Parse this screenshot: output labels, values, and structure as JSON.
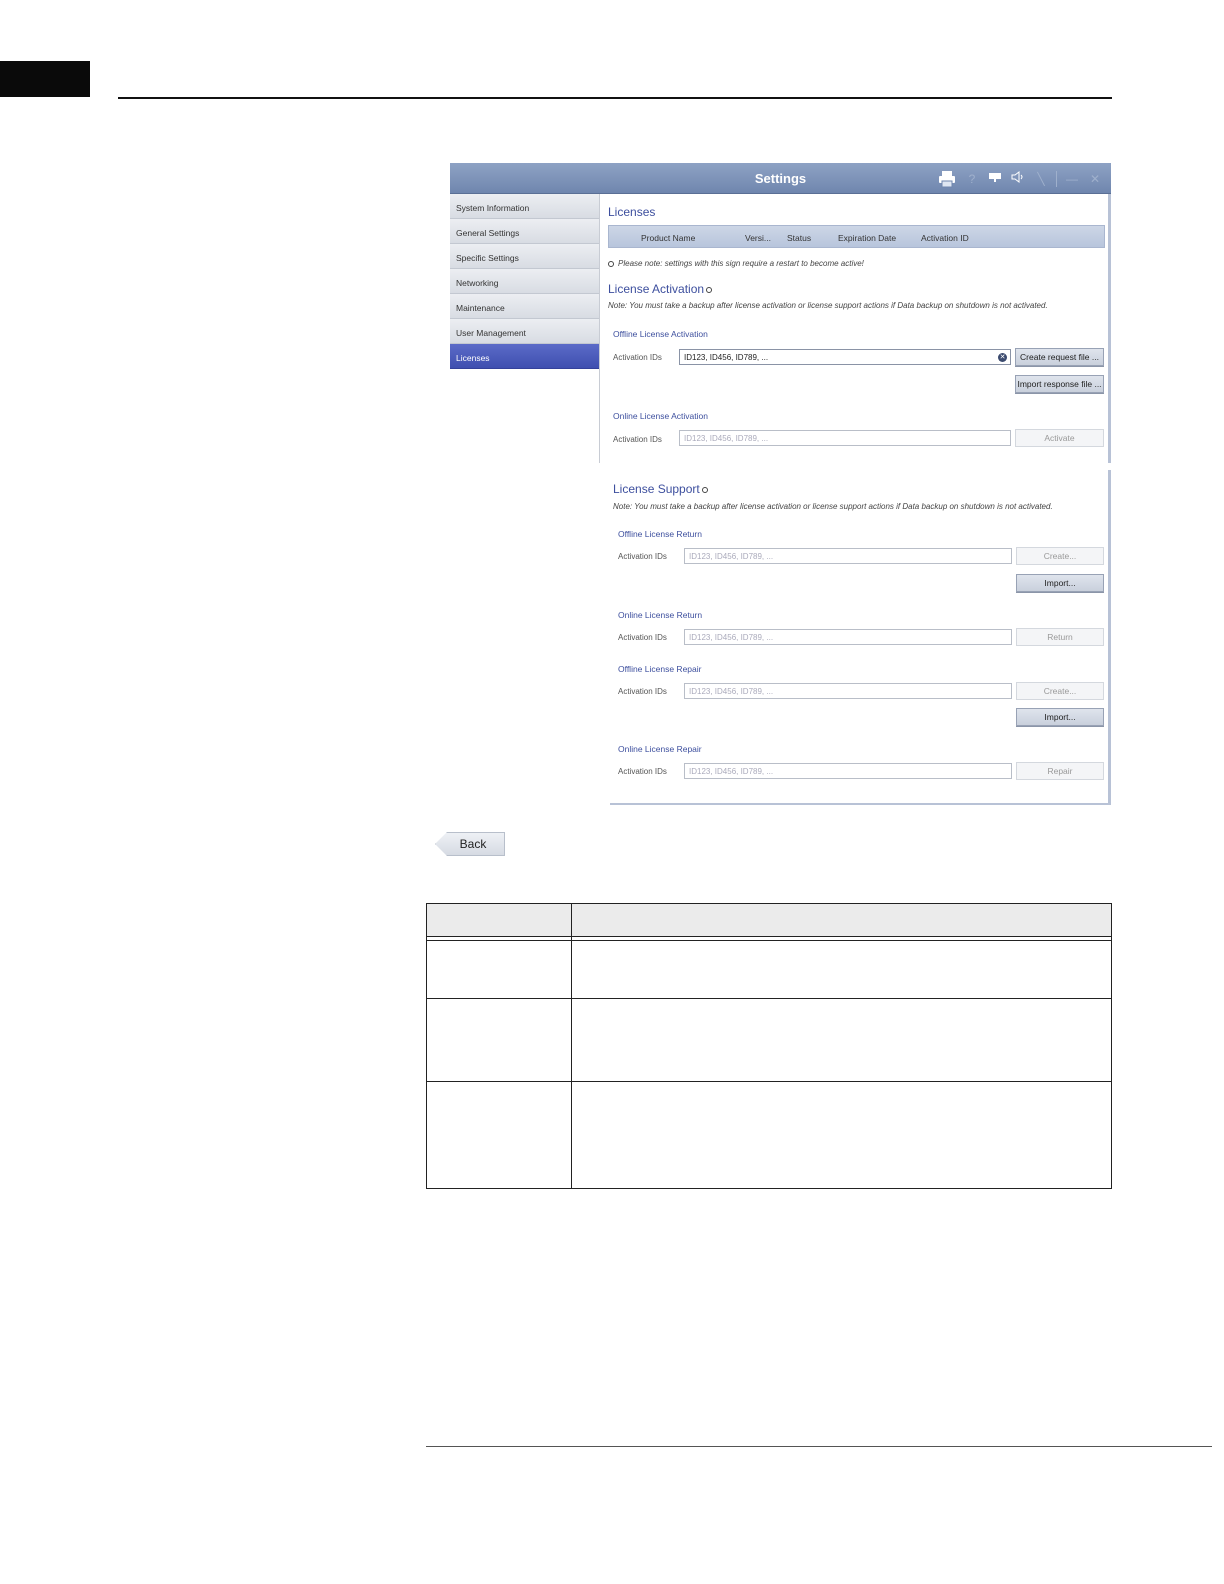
{
  "window": {
    "title": "Settings"
  },
  "sidebar": {
    "items": [
      {
        "label": "System Information"
      },
      {
        "label": "General Settings"
      },
      {
        "label": "Specific Settings"
      },
      {
        "label": "Networking"
      },
      {
        "label": "Maintenance"
      },
      {
        "label": "User Management"
      },
      {
        "label": "Licenses",
        "active": true
      }
    ]
  },
  "licenses": {
    "heading": "Licenses",
    "columns": [
      "Product Name",
      "Versi...",
      "Status",
      "Expiration Date",
      "Activation ID"
    ],
    "restart_note": "Please note: settings with this sign require a restart to become active!"
  },
  "activation": {
    "heading": "License Activation",
    "note": "Note: You must take a backup after license activation or license support actions if Data backup on shutdown is not activated.",
    "offline": {
      "title": "Offline License Activation",
      "label": "Activation IDs",
      "value": "ID123, ID456, ID789, ...",
      "create_btn": "Create request file ...",
      "import_btn": "Import response file ..."
    },
    "online": {
      "title": "Online License Activation",
      "label": "Activation IDs",
      "placeholder": "ID123, ID456, ID789, ...",
      "activate_btn": "Activate"
    }
  },
  "support": {
    "heading": "License Support",
    "note": "Note: You must take a backup after license activation or license support actions if Data backup on shutdown is not activated.",
    "offline_return": {
      "title": "Offline License Return",
      "label": "Activation IDs",
      "placeholder": "ID123, ID456, ID789, ...",
      "create_btn": "Create...",
      "import_btn": "Import..."
    },
    "online_return": {
      "title": "Online License Return",
      "label": "Activation IDs",
      "placeholder": "ID123, ID456, ID789, ...",
      "return_btn": "Return"
    },
    "offline_repair": {
      "title": "Offline License Repair",
      "label": "Activation IDs",
      "placeholder": "ID123, ID456, ID789, ...",
      "create_btn": "Create...",
      "import_btn": "Import..."
    },
    "online_repair": {
      "title": "Online License Repair",
      "label": "Activation IDs",
      "placeholder": "ID123, ID456, ID789, ...",
      "repair_btn": "Repair"
    }
  },
  "back_button": "Back",
  "icons": {
    "print": "printer-icon",
    "help": "help-icon",
    "display": "monitor-icon",
    "volume": "speaker-icon",
    "tool": "wrench-icon",
    "minimize": "minimize-icon",
    "close": "close-icon"
  }
}
